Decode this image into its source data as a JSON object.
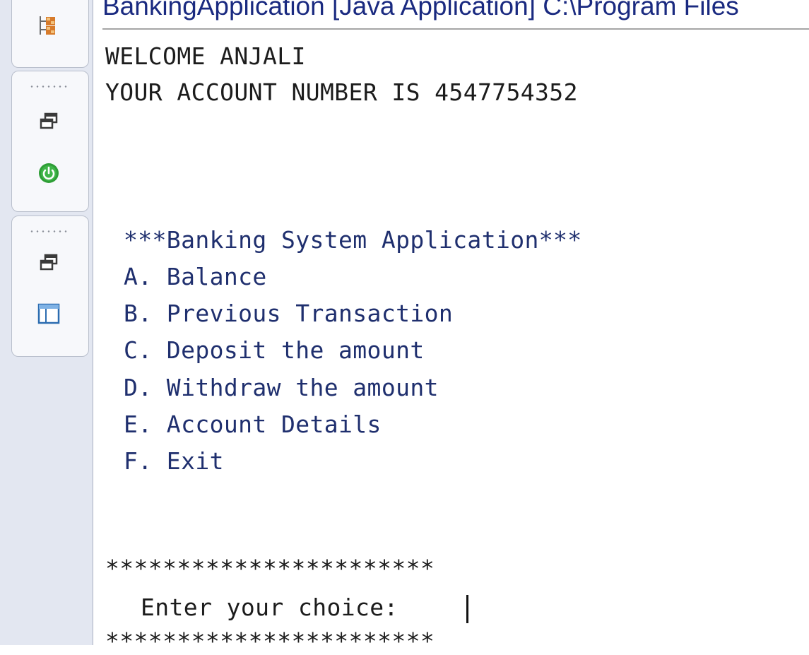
{
  "console": {
    "header": "BankingApplication [Java Application] C:\\Program Files",
    "welcome": "WELCOME ANJALI",
    "account_line": "YOUR ACCOUNT NUMBER IS 4547754352",
    "menu_title": "***Banking System Application***",
    "menu_items": [
      "A. Balance",
      "B. Previous Transaction",
      "C. Deposit the amount",
      "D. Withdraw the amount",
      "E. Account Details",
      "F. Exit"
    ],
    "separator_top": "***********************",
    "prompt": "Enter your choice: ",
    "separator_bottom": "***********************"
  },
  "trim": {
    "icons": [
      "hierarchy-icon",
      "restore-icon",
      "spring-boot-icon",
      "restore-icon",
      "window-layout-icon"
    ]
  },
  "colors": {
    "trim_background": "#e3e7f1",
    "spring_green": "#2e9e36",
    "menu_text": "#1f2f6e",
    "header_text": "#1a2a80"
  }
}
